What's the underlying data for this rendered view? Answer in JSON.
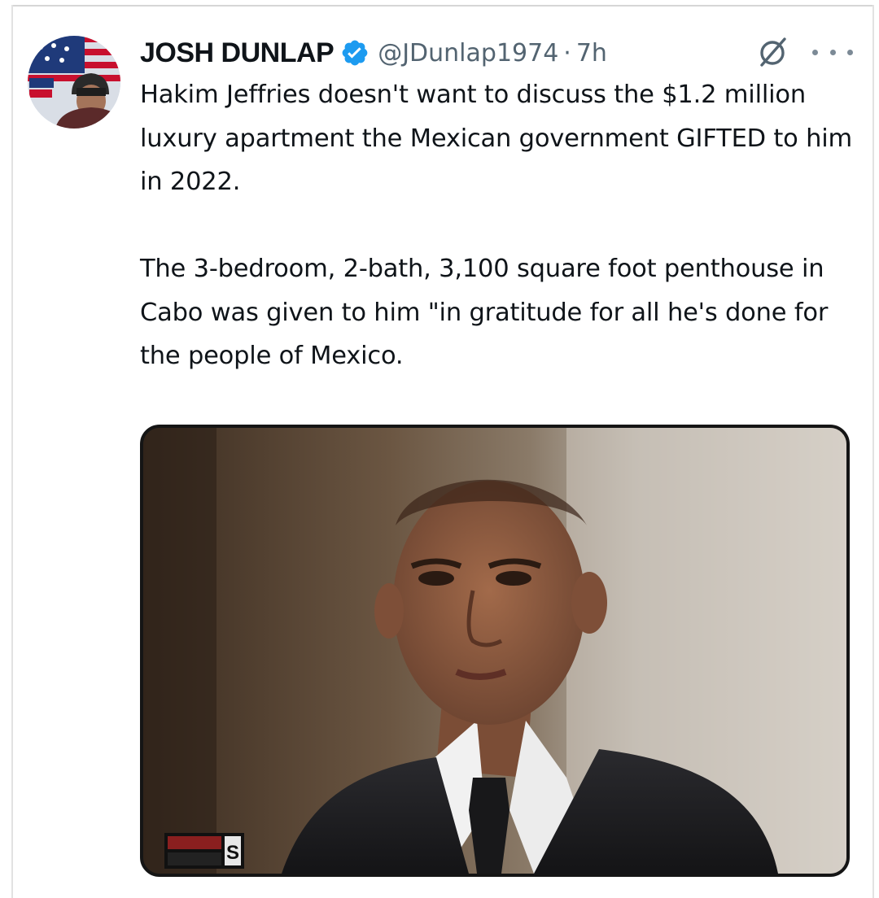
{
  "tweet": {
    "author": {
      "display_name": "JOSH DUNLAP",
      "handle": "@JDunlap1974",
      "time_separator": "·",
      "time": "7h",
      "verified": true,
      "avatar_icon": "avatar-flag-photo"
    },
    "body_paragraphs": [
      "Hakim Jeffries doesn't want to discuss the $1.2 million luxury apartment the Mexican government GIFTED to him in 2022.",
      "The 3-bedroom, 2-bath, 3,100 square foot penthouse in Cabo was given to him \"in gratitude for all he's done for the people of Mexico."
    ],
    "media": {
      "kind": "photo",
      "subject": "man-in-suit-portrait"
    },
    "icons": {
      "verified": "verified-badge-icon",
      "grok": "grok-icon",
      "more": "more-options-icon"
    },
    "colors": {
      "verified_blue": "#1d9bf0",
      "secondary_text": "#536471",
      "primary_text": "#0f1419"
    }
  }
}
